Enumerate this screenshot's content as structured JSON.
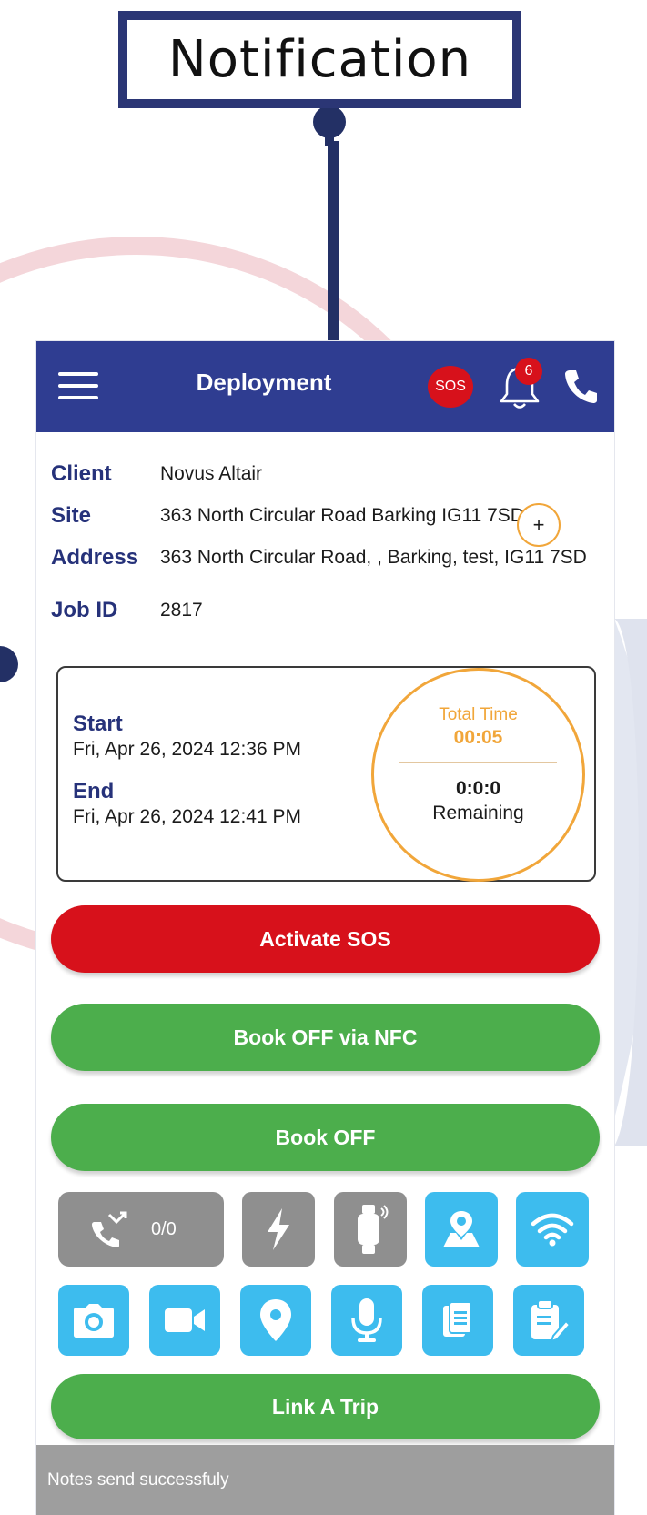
{
  "callout": {
    "label": "Notification"
  },
  "appbar": {
    "title": "Deployment",
    "sos_label": "SOS",
    "notification_count": "6",
    "menu_icon": "hamburger-menu-icon",
    "bell_icon": "bell-icon",
    "phone_icon": "phone-icon"
  },
  "info": {
    "client_label": "Client",
    "client_value": "Novus Altair",
    "site_label": "Site",
    "site_value": "363 North Circular Road Barking IG11 7SD",
    "address_label": "Address",
    "address_value": "363 North Circular Road, , Barking, test, IG11 7SD",
    "job_label": "Job ID",
    "job_value": "2817"
  },
  "shift": {
    "start_label": "Start",
    "start_value": "Fri, Apr 26, 2024 12:36 PM",
    "end_label": "End",
    "end_value": "Fri, Apr 26, 2024 12:41 PM",
    "total_time_label": "Total Time",
    "total_time_value": "00:05",
    "remaining_value": "0:0:0",
    "remaining_label": "Remaining",
    "add_label": "+"
  },
  "actions": {
    "sos_button": "Activate SOS",
    "nfc_button": "Book OFF via NFC",
    "bookoff_button": "Book OFF",
    "link_trip_button": "Link A Trip"
  },
  "tools": {
    "call_count": "0/0",
    "row1_icons": [
      "missed-call-icon",
      "flash-icon",
      "smartwatch-icon",
      "map-location-icon",
      "wifi-icon"
    ],
    "row2_icons": [
      "camera-icon",
      "video-icon",
      "location-pin-icon",
      "microphone-icon",
      "documents-icon",
      "clipboard-edit-icon"
    ]
  },
  "toast": {
    "message": "Notes send successfuly"
  },
  "colors": {
    "primary": "#2f3d91",
    "danger": "#d7111b",
    "success": "#4cae4c",
    "accent_blue": "#3dbcee",
    "disabled_gray": "#8f8f8f",
    "timer_orange": "#f1a63a"
  }
}
